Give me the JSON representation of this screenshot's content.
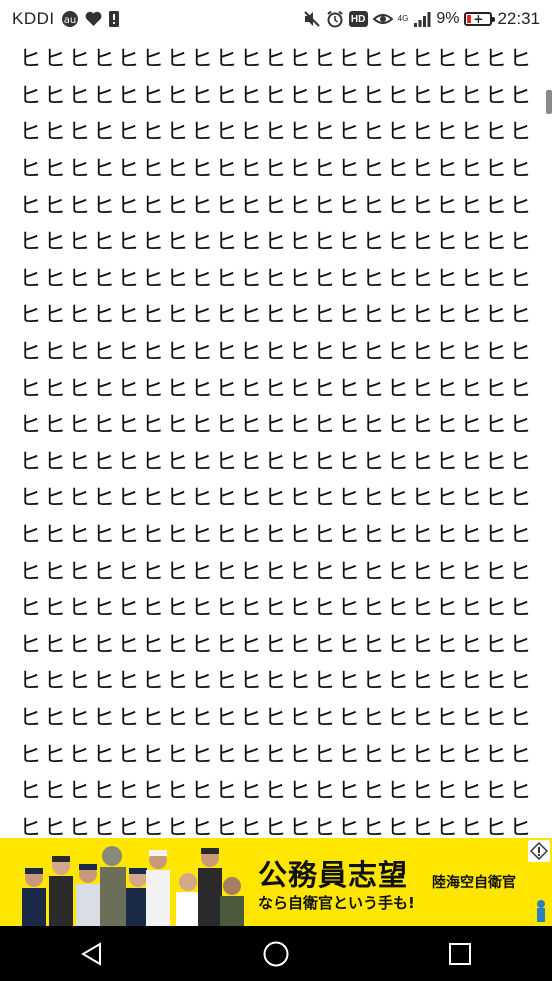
{
  "status_bar": {
    "carrier": "KDDI",
    "network_type": "4G",
    "battery_percent": "9%",
    "time": "22:31",
    "hd_label": "HD",
    "icons": [
      "au-logo-icon",
      "heart-icon",
      "sim-alert-icon",
      "mute-icon",
      "alarm-icon",
      "hd-icon",
      "eye-comfort-icon",
      "signal-icon",
      "battery-charging-icon"
    ]
  },
  "content": {
    "character": "ヒ",
    "rows": [
      "ヒヒヒヒヒヒヒヒヒヒヒヒヒヒヒヒヒヒヒヒヒ",
      "ヒヒヒヒヒヒヒヒヒヒヒヒヒヒヒヒヒヒヒヒヒ",
      "ヒヒヒヒヒヒヒヒヒヒヒヒヒヒヒヒヒヒヒヒヒ",
      "ヒヒヒヒヒヒヒヒヒヒヒヒヒヒヒヒヒヒヒヒヒ",
      "ヒヒヒヒヒヒヒヒヒヒヒヒヒヒヒヒヒヒヒヒヒ",
      "ヒヒヒヒヒヒヒヒヒヒヒヒヒヒヒヒヒヒヒヒヒ",
      "ヒヒヒヒヒヒヒヒヒヒヒヒヒヒヒヒヒヒヒヒヒ",
      "ヒヒヒヒヒヒヒヒヒヒヒヒヒヒヒヒヒヒヒヒヒ",
      "ヒヒヒヒヒヒヒヒヒヒヒヒヒヒヒヒヒヒヒヒヒ",
      "ヒヒヒヒヒヒヒヒヒヒヒヒヒヒヒヒヒヒヒヒヒ",
      "ヒヒヒヒヒヒヒヒヒヒヒヒヒヒヒヒヒヒヒヒヒ",
      "ヒヒヒヒヒヒヒヒヒヒヒヒヒヒヒヒヒヒヒヒヒ",
      "ヒヒヒヒヒヒヒヒヒヒヒヒヒヒヒヒヒヒヒヒヒ",
      "ヒヒヒヒヒヒヒヒヒヒヒヒヒヒヒヒヒヒヒヒヒ",
      "ヒヒヒヒヒヒヒヒヒヒヒヒヒヒヒヒヒヒヒヒヒ",
      "ヒヒヒヒヒヒヒヒヒヒヒヒヒヒヒヒヒヒヒヒヒ",
      "ヒヒヒヒヒヒヒヒヒヒヒヒヒヒヒヒヒヒヒヒヒ",
      "ヒヒヒヒヒヒヒヒヒヒヒヒヒヒヒヒヒヒヒヒヒ",
      "ヒヒヒヒヒヒヒヒヒヒヒヒヒヒヒヒヒヒヒヒヒ",
      "ヒヒヒヒヒヒヒヒヒヒヒヒヒヒヒヒヒヒヒヒヒ",
      "ヒヒヒヒヒヒヒヒヒヒヒヒヒヒヒヒヒヒヒヒヒ",
      "ヒヒヒヒヒヒヒヒヒヒヒヒヒヒヒヒヒヒヒヒヒ"
    ]
  },
  "ad": {
    "headline": "公務員志望",
    "subtext": "なら自衛官という手も!",
    "badge": "陸海空自衛官",
    "background_color": "#ffe600"
  },
  "nav_bar": {
    "back_icon": "back-triangle-icon",
    "home_icon": "home-circle-icon",
    "recents_icon": "recents-square-icon"
  }
}
